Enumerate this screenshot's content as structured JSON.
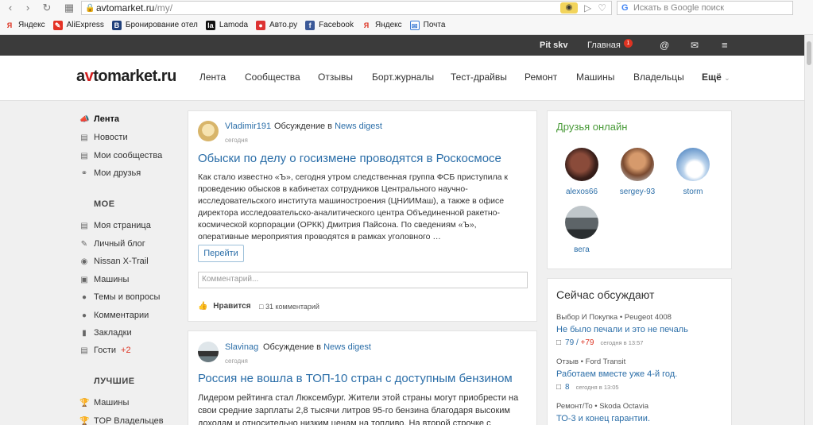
{
  "browser": {
    "address_host": "avtomarket.ru",
    "address_path": "/my/",
    "search_placeholder": "Искать в Google поиск",
    "bookmarks": [
      "Яндекс",
      "AliExpress",
      "Бронирование отел",
      "Lamoda",
      "Авто.ру",
      "Facebook",
      "Яндекс",
      "Почта"
    ]
  },
  "topbar": {
    "user": "Pit skv",
    "home": "Главная",
    "badge": "1",
    "at": "@",
    "mail_icon": "envelope-icon",
    "menu_icon": "hamburger-icon"
  },
  "header": {
    "logo_a": "a",
    "logo_v": "v",
    "logo_rest": "tomarket.ru",
    "nav": [
      "Лента",
      "Сообщества",
      "Отзывы",
      "Борт.журналы",
      "Тест-драйвы",
      "Ремонт",
      "Машины",
      "Владельцы",
      "Ещё"
    ]
  },
  "sidebar": {
    "main": [
      {
        "label": "Лента",
        "icon": "megaphone-icon"
      },
      {
        "label": "Новости",
        "icon": "news-icon"
      },
      {
        "label": "Мои сообщества",
        "icon": "book-icon"
      },
      {
        "label": "Мои друзья",
        "icon": "link-icon"
      }
    ],
    "mine_header": "МОЕ",
    "mine": [
      {
        "label": "Моя страница",
        "icon": "page-icon"
      },
      {
        "label": "Личный блог",
        "icon": "pencil-icon"
      },
      {
        "label": "Nissan X-Trail",
        "icon": "steering-icon"
      },
      {
        "label": "Машины",
        "icon": "car-icon"
      },
      {
        "label": "Темы и вопросы",
        "icon": "bubble-icon"
      },
      {
        "label": "Комментарии",
        "icon": "comment-icon"
      },
      {
        "label": "Закладки",
        "icon": "bookmark-icon"
      },
      {
        "label": "Гости",
        "icon": "guests-icon",
        "count": "+2"
      }
    ],
    "best_header": "ЛУЧШИЕ",
    "best": [
      {
        "label": "Машины",
        "icon": "trophy-icon"
      },
      {
        "label": "TOP Владельцев",
        "icon": "trophy-icon"
      }
    ]
  },
  "posts": [
    {
      "author": "Vladimir191",
      "discuss_prefix": "Обсуждение в",
      "discuss_link": "News digest",
      "date": "сегодня",
      "title": "Обыски по делу о госизмене проводятся в Роскосмосе",
      "body": "Как стало известно «Ъ», сегодня утром следственная группа ФСБ приступила к проведению обысков в кабинетах сотрудников Центрального научно-исследовательского института машиностроения (ЦНИИМаш), а также в офисе директора исследовательско-аналитического центра Объединенной ракетно-космической корпорации (ОРКК) Дмитрия Пайсона. По сведениям «Ъ», оперативные мероприятия проводятся в рамках уголовного …",
      "button": "Перейти",
      "comment_placeholder": "Комментарий...",
      "like": "Нравится",
      "comments": "31 комментарий"
    },
    {
      "author": "Slavinag",
      "discuss_prefix": "Обсуждение в",
      "discuss_link": "News digest",
      "date": "сегодня",
      "title": "Россия не вошла в ТОП-10 стран с доступным бензином",
      "body": "Лидером рейтинга стал Люксембург. Жители этой страны могут приобрести на свои средние зарплаты 2,8 тысячи литров 95-го бензина благодаря высоким доходам и относительно низким ценам на топливо. На второй строчке с расположилась Норвегия"
    }
  ],
  "friends_widget": {
    "title": "Друзья онлайн",
    "friends": [
      "alexos66",
      "sergey-93",
      "storm",
      "вега"
    ]
  },
  "discussions": {
    "title": "Сейчас обсуждают",
    "items": [
      {
        "category": "Выбор И Покупка • Peugeot 4008",
        "title": "Не было печали и это не печаль",
        "count": "79",
        "delta": "+79",
        "time": "сегодня в 13:57"
      },
      {
        "category": "Отзыв • Ford Transit",
        "title": "Работаем вместе уже 4-й год.",
        "count": "8",
        "time": "сегодня в 13:05"
      },
      {
        "category": "Ремонт/То • Skoda Octavia",
        "title": "ТО-3 и конец гарантии."
      }
    ]
  }
}
